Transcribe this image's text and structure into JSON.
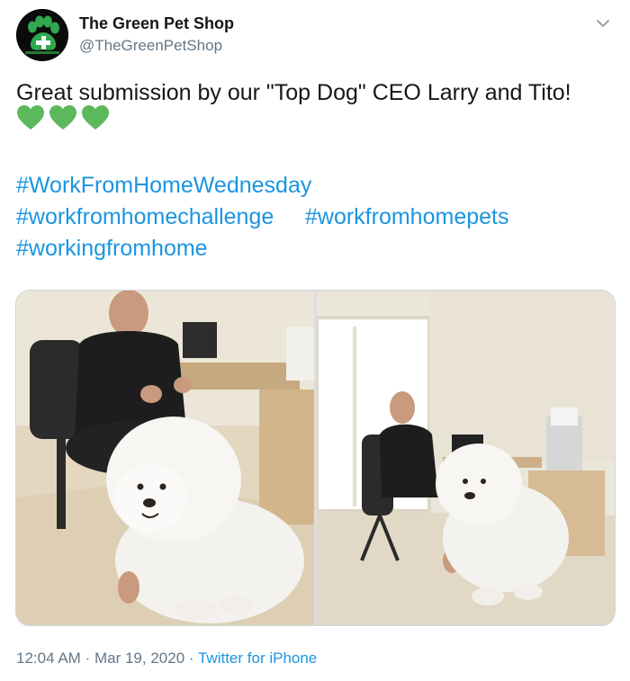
{
  "author": {
    "name": "The Green Pet Shop",
    "handle": "@TheGreenPetShop"
  },
  "tweet": {
    "text": "Great submission by our \"Top Dog\" CEO Larry and Tito!",
    "emoji": "green-heart",
    "emoji_count": 3,
    "hashtags": [
      "#WorkFromHomeWednesday",
      "#workfromhomechallenge",
      "#workfromhomepets",
      "#workingfromhome"
    ]
  },
  "meta": {
    "time": "12:04 AM",
    "separator": "·",
    "date": "Mar 19, 2020",
    "source": "Twitter for iPhone"
  },
  "colors": {
    "link": "#1b95e0",
    "secondary_text": "#657786",
    "heart": "#5cb85c",
    "brand_green": "#2fa84f"
  },
  "icons": {
    "more": "chevron-down-icon",
    "avatar": "paw-logo"
  }
}
